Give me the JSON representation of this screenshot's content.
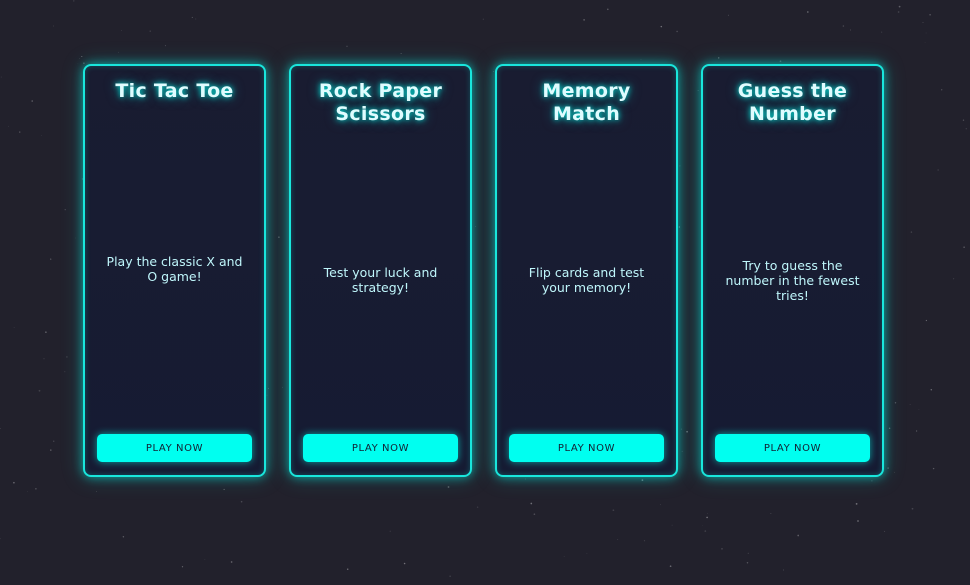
{
  "colors": {
    "background": "#22212c",
    "card_background": "#181c32",
    "neon_accent": "#00fff0",
    "title_text": "#dffcff",
    "button_text": "#132033"
  },
  "games": [
    {
      "title": "Tic Tac Toe",
      "description": "Play the classic X and O game!",
      "button_label": "PLAY NOW"
    },
    {
      "title": "Rock Paper Scissors",
      "description": "Test your luck and strategy!",
      "button_label": "PLAY NOW"
    },
    {
      "title": "Memory Match",
      "description": "Flip cards and test your memory!",
      "button_label": "PLAY NOW"
    },
    {
      "title": "Guess the Number",
      "description": "Try to guess the number in the fewest tries!",
      "button_label": "PLAY NOW"
    }
  ]
}
